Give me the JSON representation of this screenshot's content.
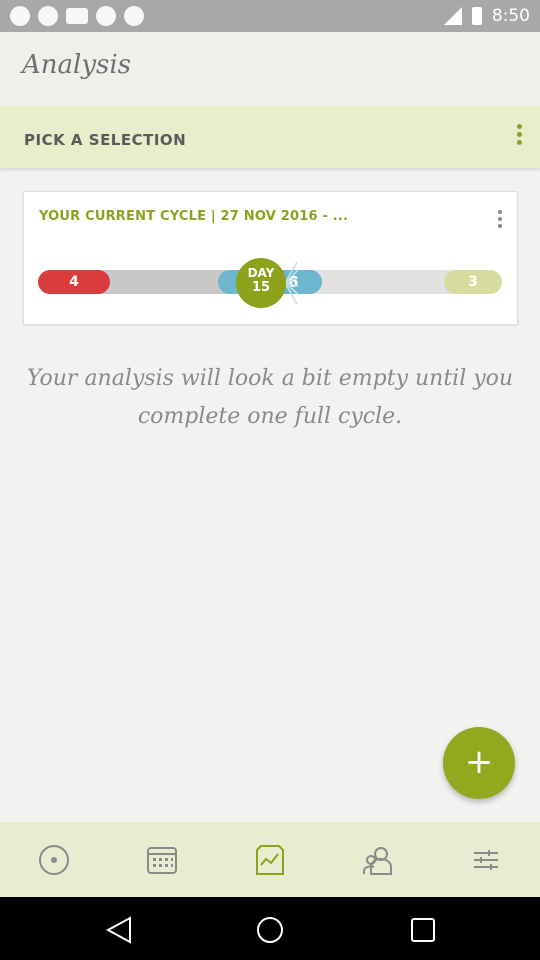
{
  "status_bar": {
    "time": "8:50"
  },
  "header": {
    "title": "Analysis"
  },
  "selection": {
    "label": "PICK A SELECTION"
  },
  "cycle_card": {
    "title": "YOUR CURRENT CYCLE | 27 NOV 2016 - ...",
    "period_days": "4",
    "day_label": "DAY",
    "day_number": "15",
    "fertile_days": "6",
    "remaining_days": "3"
  },
  "message": "Your analysis will look a bit empty until you complete one full cycle.",
  "bottom_nav": {
    "items": [
      {
        "icon": "cycle-icon",
        "active": false
      },
      {
        "icon": "calendar-icon",
        "active": false
      },
      {
        "icon": "analysis-icon",
        "active": true
      },
      {
        "icon": "partner-icon",
        "active": false
      },
      {
        "icon": "settings-icon",
        "active": false
      }
    ]
  },
  "colors": {
    "accent": "#8da11a",
    "period": "#d93c3c",
    "fertile": "#6cb6cf",
    "nav_bg": "#e8ecd0"
  }
}
